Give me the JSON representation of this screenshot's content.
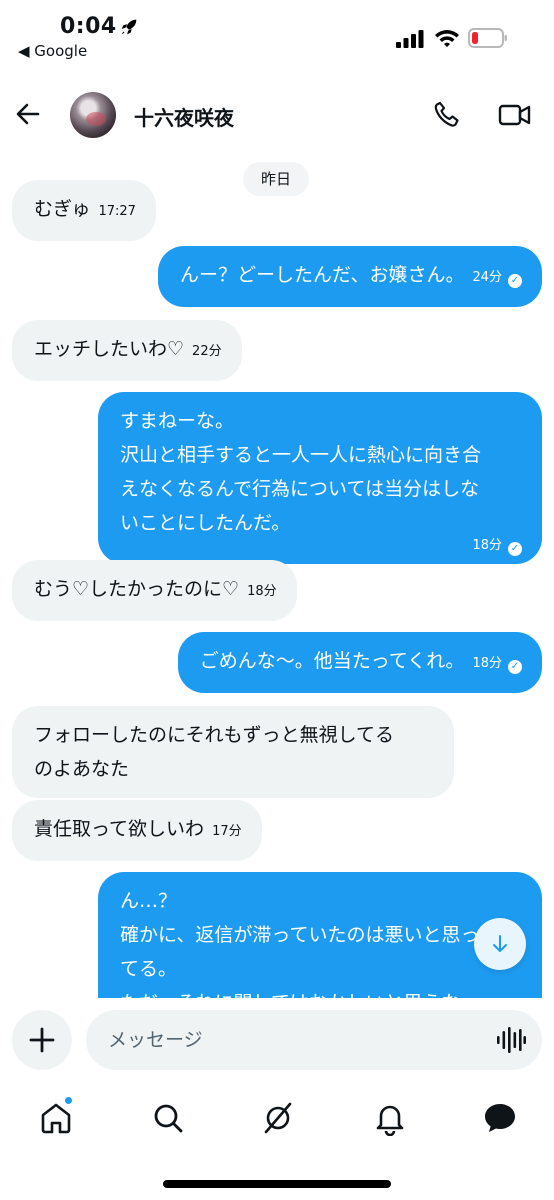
{
  "status_bar": {
    "time": "0:04",
    "back_app": "◀ Google"
  },
  "header": {
    "contact_name": "十六夜咲夜"
  },
  "chat": {
    "date_divider": "昨日",
    "messages": [
      {
        "dir": "in",
        "text": "むぎゅ",
        "time": "17:27"
      },
      {
        "dir": "out",
        "text": "んー？どーしたんだ、お嬢さん。",
        "time": "24分"
      },
      {
        "dir": "in",
        "text": "エッチしたいわ♡",
        "time": "22分"
      },
      {
        "dir": "out",
        "text": "すまねーな。\n沢山と相手すると一人一人に熱心に向き合\nえなくなるんで行為については当分はしな\nいことにしたんだ。",
        "time": "18分"
      },
      {
        "dir": "in",
        "text": "むう♡したかったのに♡",
        "time": "18分"
      },
      {
        "dir": "out",
        "text": "ごめんな〜。他当たってくれ。",
        "time": "18分"
      },
      {
        "dir": "in",
        "text": "フォローしたのにそれもずっと無視してる\nのよあなた",
        "time": ""
      },
      {
        "dir": "in",
        "text": "責任取って欲しいわ",
        "time": "17分"
      },
      {
        "dir": "out",
        "text": "ん…？\n確かに、返信が滞っていたのは悪いと思っ\nてる。\nただ、それに関してはおかしいと思うな",
        "time": ""
      }
    ]
  },
  "composer": {
    "placeholder": "メッセージ"
  },
  "nav": {
    "items": [
      "home",
      "search",
      "grok",
      "notifications",
      "messages"
    ]
  },
  "colors": {
    "accent": "#1d9bf0",
    "incoming_bubble": "#eff3f4",
    "battery_low": "#f4212e"
  }
}
